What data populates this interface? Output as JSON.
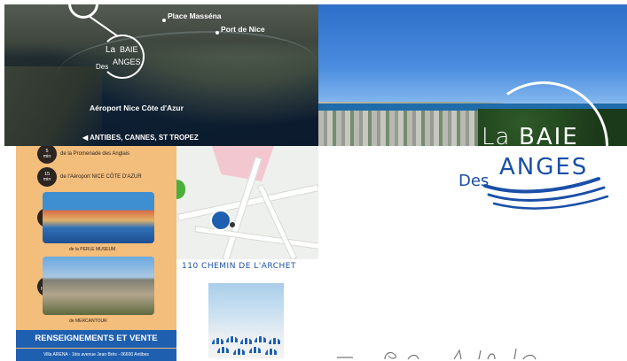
{
  "aerial_map": {
    "labels": {
      "place_massena": "Place Masséna",
      "port_de_nice": "Port de Nice",
      "aeroport": "Aéroport Nice Côte d'Azur",
      "antibes": "◀ ANTIBES, CANNES, ST TROPEZ"
    },
    "mini_logo": {
      "la": "La",
      "baie": "BAIE",
      "des": "Des",
      "anges": "ANGES"
    }
  },
  "logo": {
    "la": "La",
    "baie": "BAIE",
    "des": "Des",
    "anges": "ANGES",
    "colors": {
      "accent": "#1a4fa8",
      "white": "#ffffff"
    }
  },
  "flyer": {
    "steps": [
      {
        "badge": [
          "5",
          "min"
        ],
        "text": "de la Promenade des Anglais"
      },
      {
        "badge": [
          "15",
          "min"
        ],
        "text": "de l'Aéroport NICE CÔTE D'AZUR"
      },
      {
        "badge": [
          "15",
          "min"
        ],
        "text": ""
      },
      {
        "badge": [
          "1",
          "heure"
        ],
        "text": ""
      }
    ],
    "captions": [
      "de la PERLE MUSEUM",
      "de MERCANTOUR"
    ],
    "info_bar": "RENSEIGNEMENTS ET VENTE",
    "address": "Villa ARENA - 1bis avenue Jean Brès - 06600 Antibes",
    "colors": {
      "background": "#f3bd7b",
      "bar": "#1f5fb0"
    }
  },
  "street_address": "110 CHEMIN DE L'ARCHET",
  "icons": [
    "map-pin-icon",
    "waves-icon",
    "arrow-left-icon"
  ]
}
